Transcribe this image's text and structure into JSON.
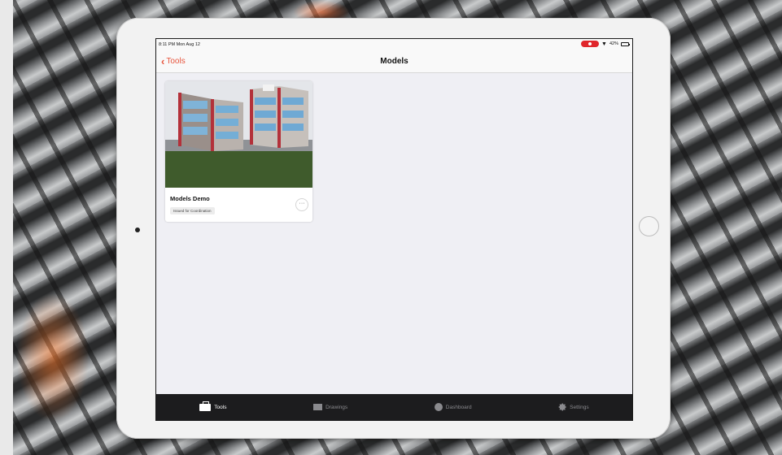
{
  "status_bar": {
    "time": "8:11 PM  Mon Aug 12",
    "battery": "42%"
  },
  "nav": {
    "back_label": "Tools",
    "title": "Models"
  },
  "models": [
    {
      "title": "Models Demo",
      "status": "Issued for Coordination",
      "more_label": "···"
    }
  ],
  "tab_bar": {
    "tabs": [
      {
        "label": "Tools",
        "icon": "toolbox-icon",
        "active": true
      },
      {
        "label": "Drawings",
        "icon": "drawings-icon",
        "active": false
      },
      {
        "label": "Dashboard",
        "icon": "dashboard-icon",
        "active": false
      },
      {
        "label": "Settings",
        "icon": "settings-icon",
        "active": false
      }
    ]
  },
  "colors": {
    "accent": "#e8553d",
    "tab_bar_bg": "#1c1c1e",
    "screen_bg": "#efeff4"
  }
}
